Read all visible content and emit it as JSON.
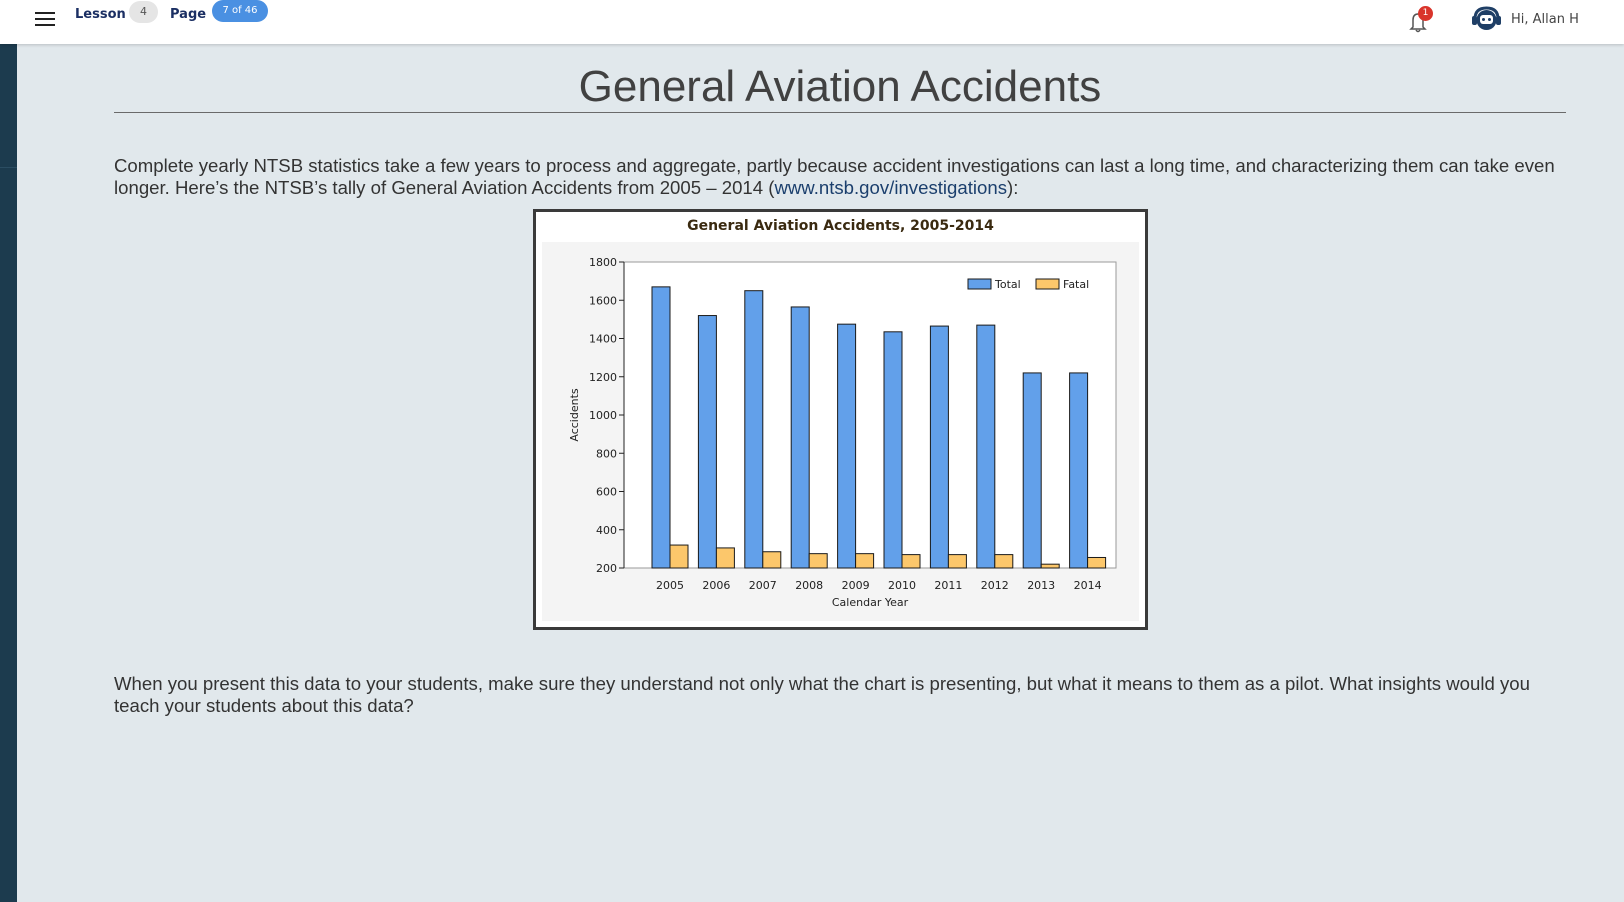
{
  "header": {
    "lesson_label": "Lesson",
    "lesson_number": "4",
    "page_label": "Page",
    "page_badge": "7 of 46",
    "notification_count": "1",
    "greeting": "Hi, Allan H"
  },
  "content": {
    "title": "General Aviation Accidents",
    "intro_text": "Complete yearly NTSB statistics take a few years to process and aggregate, partly because accident investigations can last a long time, and characterizing them can take even longer. Here’s the NTSB’s tally of General Aviation Accidents from 2005 – 2014 (",
    "intro_link": "www.ntsb.gov/investigations",
    "intro_suffix": "):",
    "question_text": "When you present this data to your students, make sure they understand not only what the chart is presenting, but what it means to them as a pilot. What insights would you teach your students about this data?"
  },
  "colors": {
    "total": "#62a0ea",
    "fatal": "#fcc76b",
    "sidebar": "#1c3b4e",
    "badge": "#4a90e2"
  },
  "icons": [
    "menu-icon",
    "bell-icon",
    "support-agent-icon"
  ],
  "chart_data": {
    "type": "bar",
    "title": "General Aviation Accidents, 2005-2014",
    "xlabel": "Calendar Year",
    "ylabel": "Accidents",
    "categories": [
      "2005",
      "2006",
      "2007",
      "2008",
      "2009",
      "2010",
      "2011",
      "2012",
      "2013",
      "2014"
    ],
    "series": [
      {
        "name": "Total",
        "values": [
          1670,
          1520,
          1650,
          1565,
          1475,
          1435,
          1465,
          1470,
          1220,
          1220
        ]
      },
      {
        "name": "Fatal",
        "values": [
          320,
          305,
          285,
          275,
          275,
          270,
          270,
          270,
          220,
          255
        ]
      }
    ],
    "ylim": [
      200,
      1800
    ],
    "yticks": [
      200,
      400,
      600,
      800,
      1000,
      1200,
      1400,
      1600,
      1800
    ],
    "legend": "top-right",
    "grid": false
  }
}
